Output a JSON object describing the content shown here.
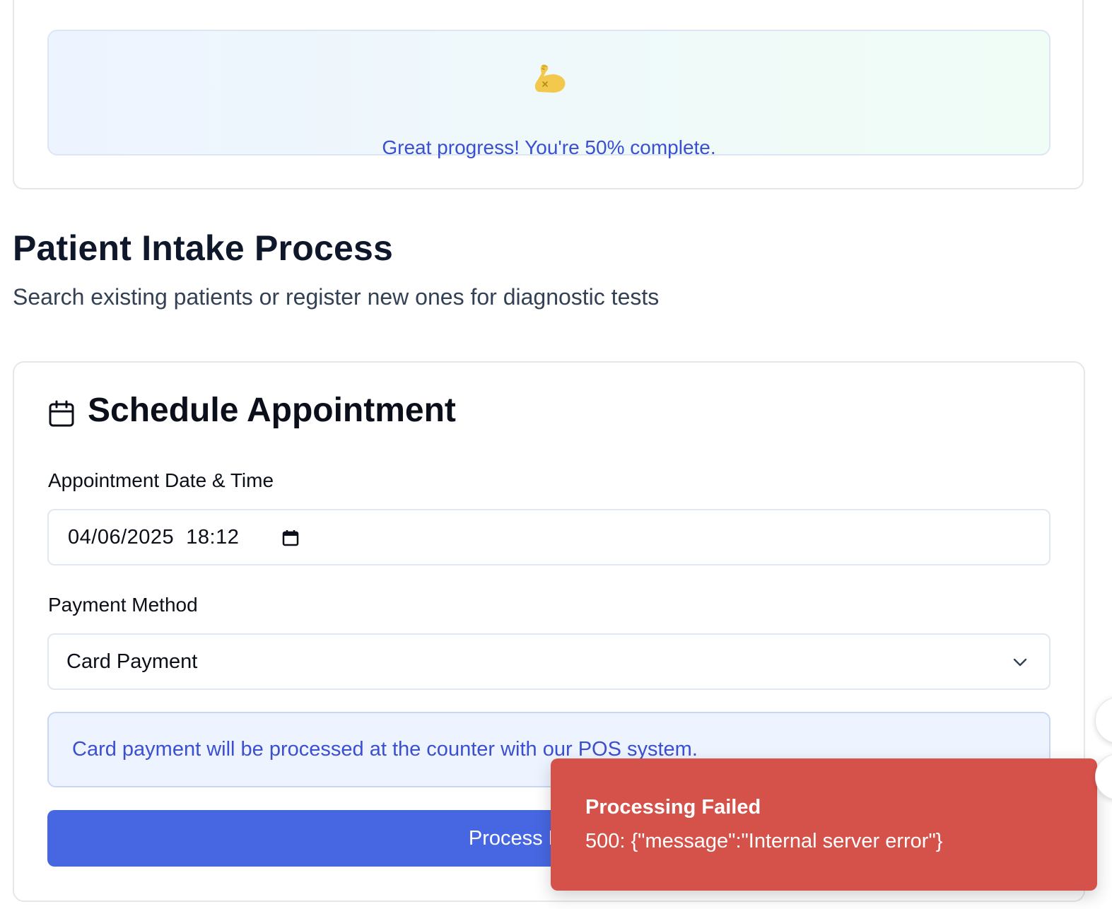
{
  "progress": {
    "percent_complete": 50,
    "message": "Great progress! You're 50% complete.",
    "icon": "flexed-biceps-icon"
  },
  "page": {
    "title": "Patient Intake Process",
    "subtitle": "Search existing patients or register new ones for diagnostic tests"
  },
  "schedule": {
    "icon": "calendar-icon",
    "title": "Schedule Appointment",
    "date_label": "Appointment Date & Time",
    "date_value": "04/06/2025  18:12",
    "payment_label": "Payment Method",
    "payment_value": "Card Payment",
    "info_text": "Card payment will be processed at the counter with our POS system.",
    "button_label": "Process Payment"
  },
  "toast": {
    "title": "Processing Failed",
    "message": "500: {\"message\":\"Internal server error\"}"
  },
  "colors": {
    "accent": "#4767e2",
    "info_text": "#3b4fd1",
    "error": "#d5524a"
  }
}
